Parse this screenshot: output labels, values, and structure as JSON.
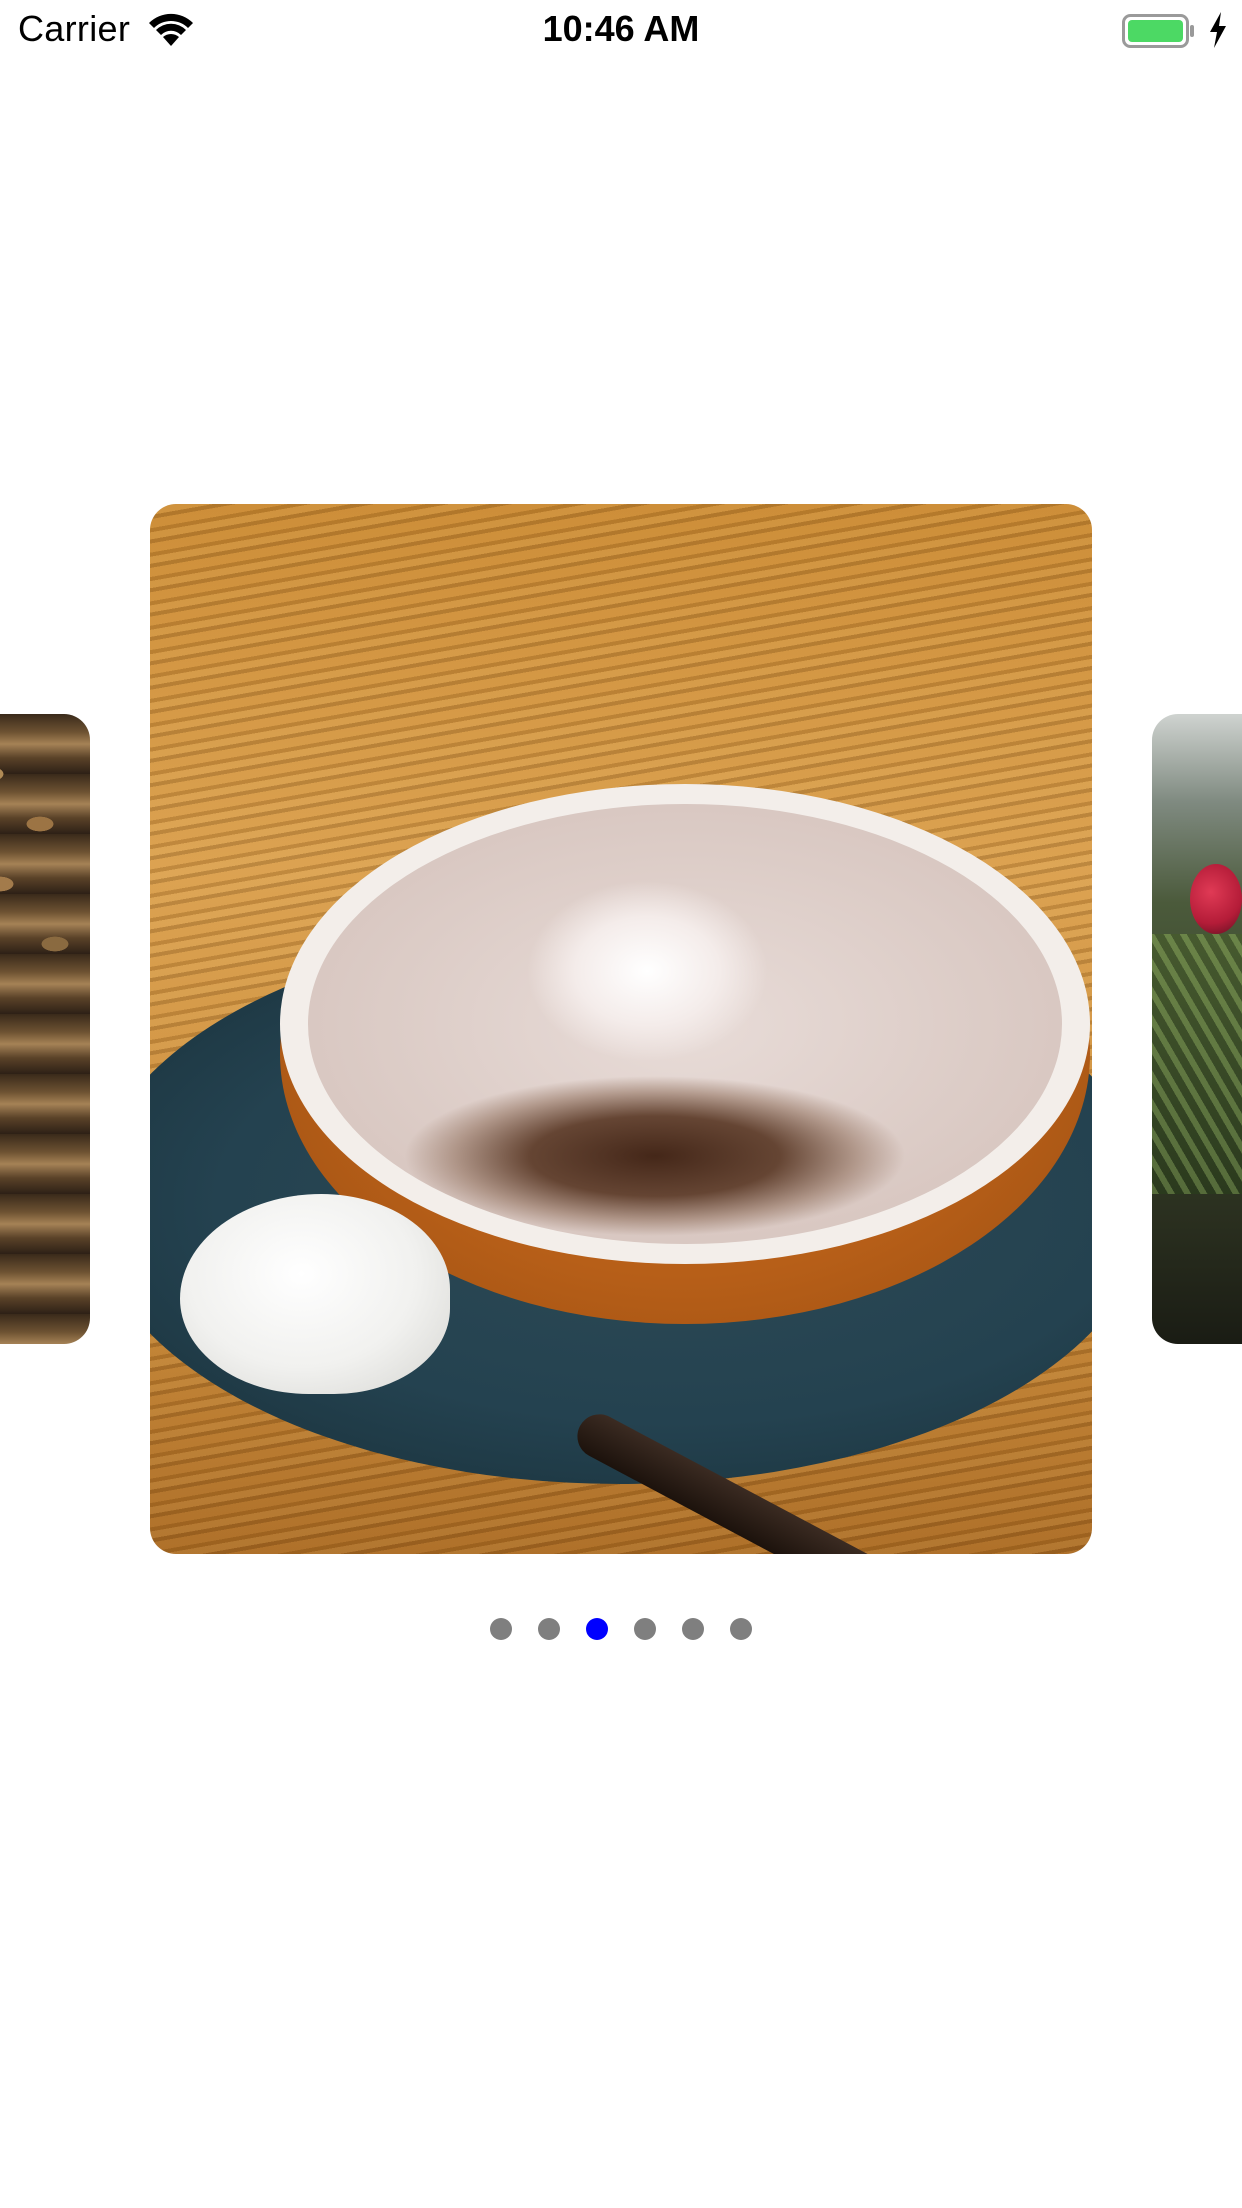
{
  "status_bar": {
    "carrier": "Carrier",
    "time": "10:46 AM",
    "battery_color": "#4cd964",
    "charging": true
  },
  "carousel": {
    "items": [
      {
        "description_icon": "coins-image"
      },
      {
        "description_icon": "coffee-cup-image"
      },
      {
        "description_icon": "flowers-image"
      }
    ],
    "current_item": "coffee-cup-image"
  },
  "page_control": {
    "page_count": 6,
    "current_page": 3,
    "active_color": "#0000ff",
    "inactive_color": "#7f7f7f"
  }
}
